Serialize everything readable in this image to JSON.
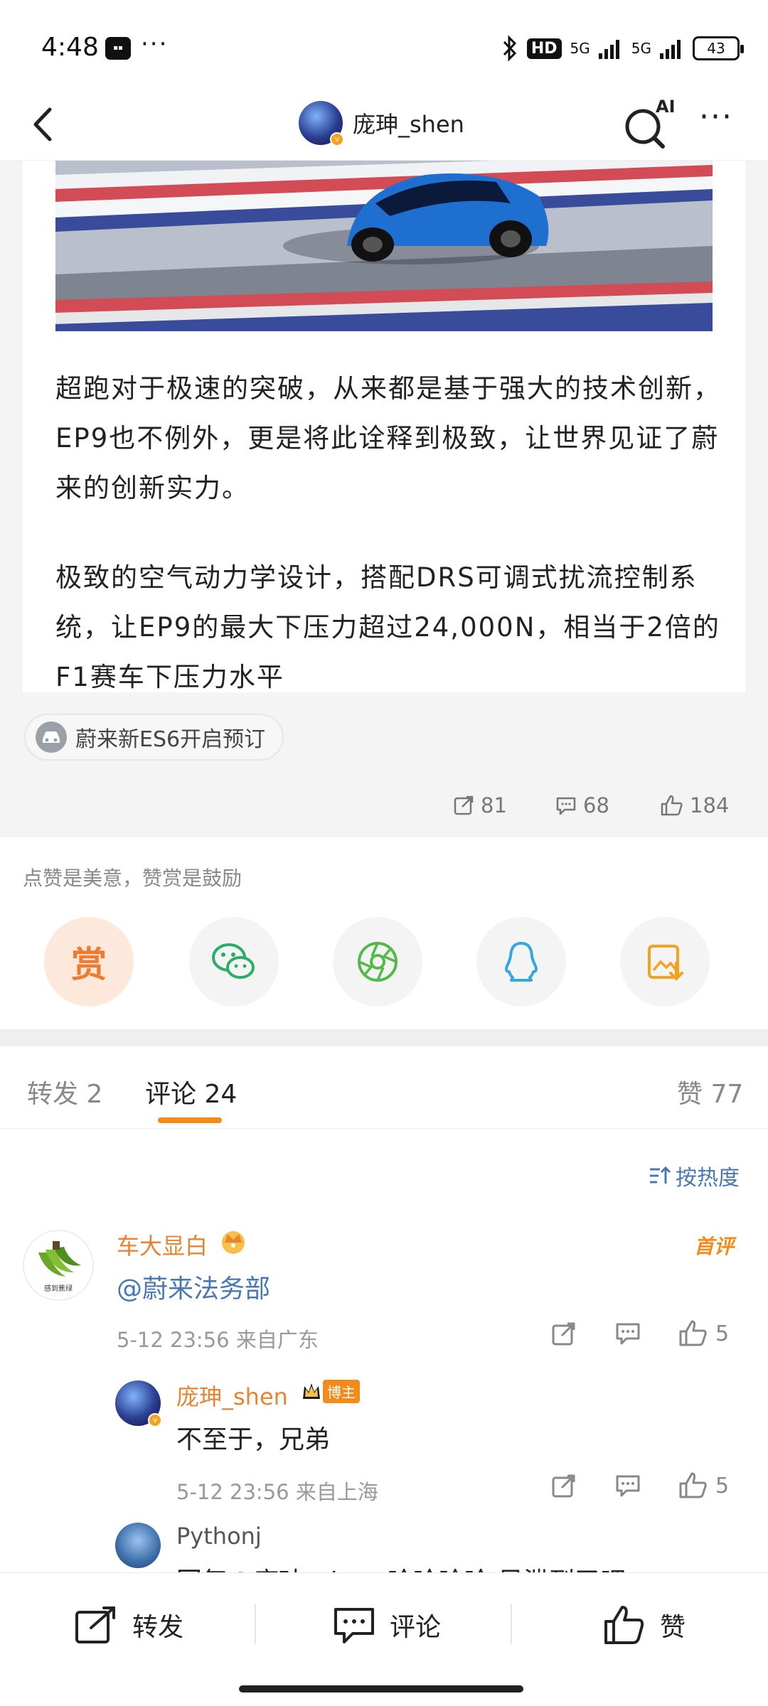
{
  "status_bar": {
    "time": "4:48",
    "more_dots": "···",
    "hd_label": "HD",
    "network_1": "5G",
    "network_2": "5G",
    "battery": "43"
  },
  "nav": {
    "username": "庞珅_shen",
    "ai_label": "AI",
    "more": "···"
  },
  "post": {
    "paragraph_1": "超跑对于极速的突破，从来都是基于强大的技术创新，EP9也不例外，更是将此诠释到极致，让世界见证了蔚来的创新实力。",
    "paragraph_2": "极致的空气动力学设计，搭配DRS可调式扰流控制系统，让EP9的最大下压力超过24,000N，相当于2倍的F1赛车下压力水平",
    "topic": "蔚来新ES6开启预订",
    "reposts": "81",
    "comments": "68",
    "likes": "184"
  },
  "reward": {
    "hint": "点赞是美意，赞赏是鼓励",
    "reward_label": "赏"
  },
  "tabs": {
    "repost": "转发 2",
    "comment": "评论 24",
    "like": "赞 77"
  },
  "sort_label": "按热度",
  "comments": [
    {
      "name": "车大显白",
      "avatar_text": "感到蕉绿",
      "first_badge": "首评",
      "text": "@蔚来法务部",
      "meta": "5-12 23:56  来自广东",
      "likes": "5"
    }
  ],
  "reply": {
    "name": "庞珅_shen",
    "badge": "博主",
    "text": "不至于，兄弟",
    "meta": "5-12 23:56  来自上海",
    "likes": "5"
  },
  "third": {
    "name": "Pythonj",
    "text": "回复@庞珅_shen:哈哈哈哈,风泄到了吧"
  },
  "bottom_bar": {
    "repost": "转发",
    "comment": "评论",
    "like": "赞"
  },
  "colors": {
    "accent_orange": "#f38b1c",
    "name_orange": "#e8842f",
    "link_blue": "#4a77b3"
  }
}
